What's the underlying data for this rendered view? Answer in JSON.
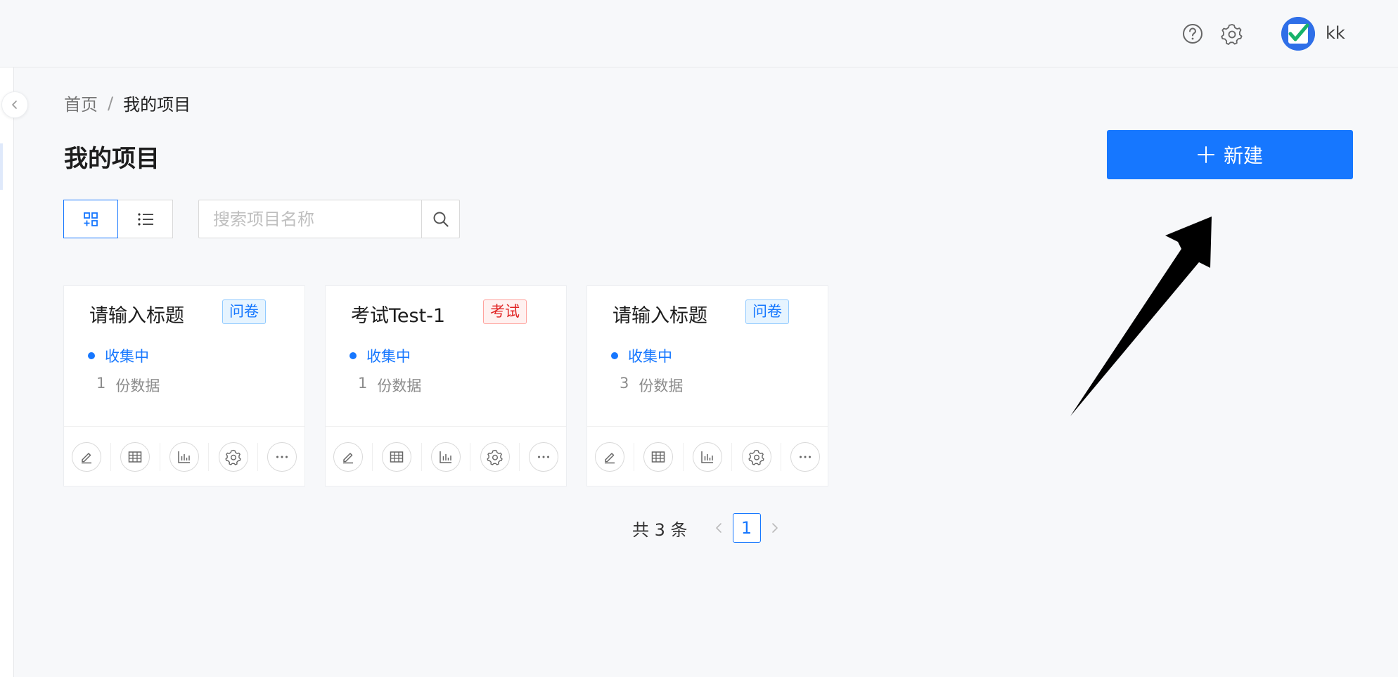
{
  "header": {
    "help_icon": "question-circle-icon",
    "settings_icon": "gear-icon",
    "username": "kk"
  },
  "breadcrumb": {
    "home": "首页",
    "separator": "/",
    "current": "我的项目"
  },
  "page": {
    "title": "我的项目",
    "new_button": "新建"
  },
  "search": {
    "placeholder": "搜索项目名称"
  },
  "projects": [
    {
      "title": "请输入标题",
      "tag": "问卷",
      "tag_color": "#1677ff",
      "status": "收集中",
      "count": "1",
      "count_unit": "份数据"
    },
    {
      "title": "考试Test-1",
      "tag": "考试",
      "tag_color": "#e02424",
      "status": "收集中",
      "count": "1",
      "count_unit": "份数据"
    },
    {
      "title": "请输入标题",
      "tag": "问卷",
      "tag_color": "#1677ff",
      "status": "收集中",
      "count": "3",
      "count_unit": "份数据"
    }
  ],
  "card_actions": [
    "edit-icon",
    "table-icon",
    "chart-icon",
    "gear-icon",
    "more-icon"
  ],
  "pagination": {
    "total": "共 3 条",
    "current": "1"
  },
  "colors": {
    "primary": "#1677ff",
    "exam_tag": "#e02424",
    "background": "#f7f8fa"
  }
}
